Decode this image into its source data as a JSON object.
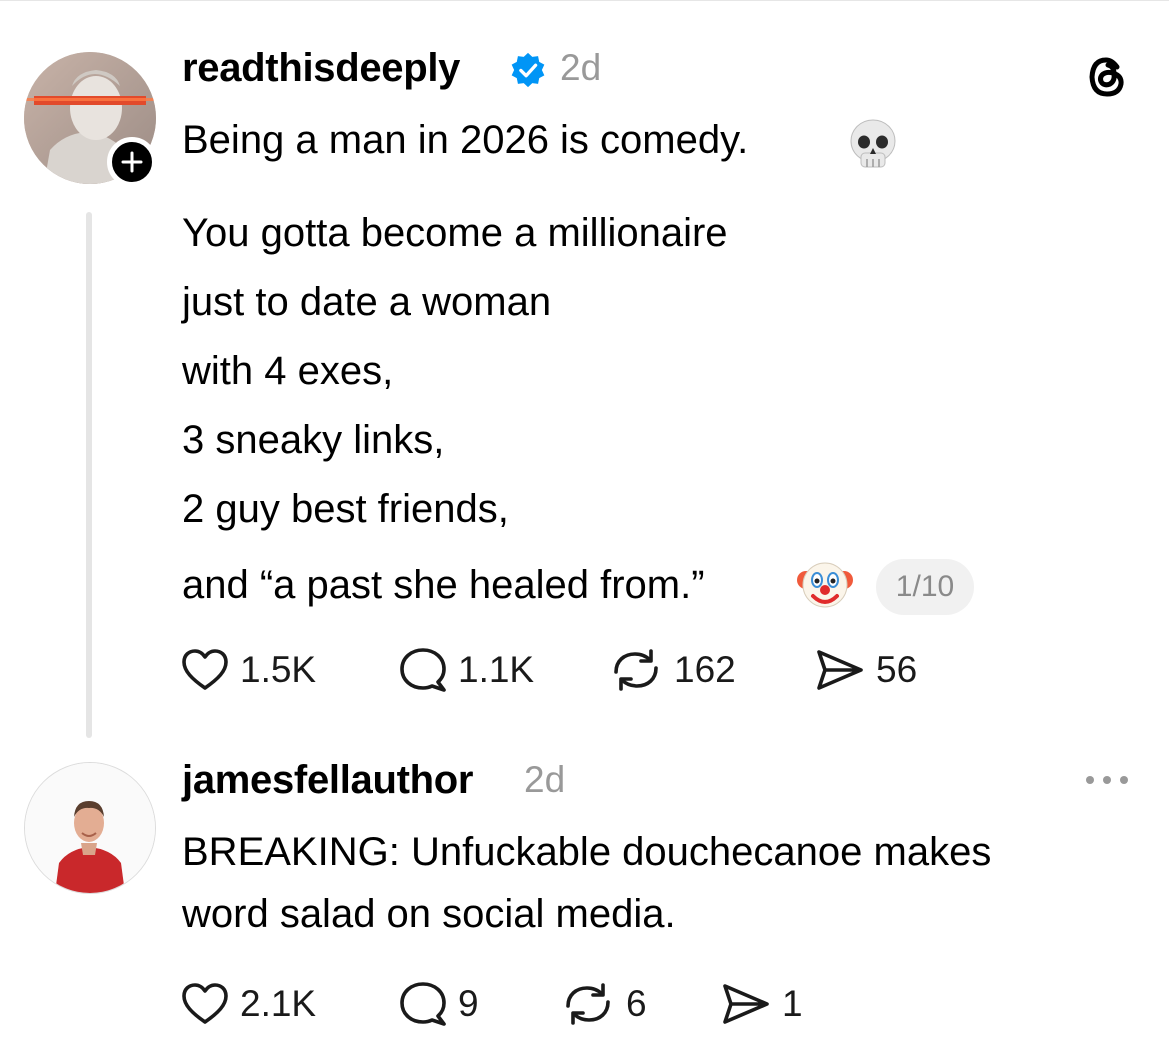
{
  "post": {
    "username": "readthisdeeply",
    "time": "2d",
    "lines": [
      "Being a man in 2026 is comedy.",
      "You gotta become a millionaire",
      "just to date a woman",
      "with 4 exes,",
      "3 sneaky links,",
      "2 guy best friends,",
      "and “a past she healed from.”"
    ],
    "page_indicator": "1/10",
    "likes": "1.5K",
    "comments": "1.1K",
    "reposts": "162",
    "shares": "56"
  },
  "reply": {
    "username": "jamesfellauthor",
    "time": "2d",
    "lines": [
      "BREAKING: Unfuckable douchecanoe makes",
      "word salad on social media."
    ],
    "likes": "2.1K",
    "comments": "9",
    "reposts": "6",
    "shares": "1"
  },
  "icons": {
    "verified": "verified-badge-icon",
    "threads_logo": "threads-logo-icon",
    "follow": "plus-icon",
    "like": "heart-icon",
    "comment": "speech-bubble-icon",
    "repost": "repost-arrows-icon",
    "share": "paper-plane-icon",
    "more": "more-dots-icon",
    "emoji_1": "skull-emoji",
    "emoji_2": "clown-emoji"
  },
  "colors": {
    "verified_blue": "#0095f6",
    "muted_gray": "#999999",
    "thread_line": "#e5e5e5"
  }
}
